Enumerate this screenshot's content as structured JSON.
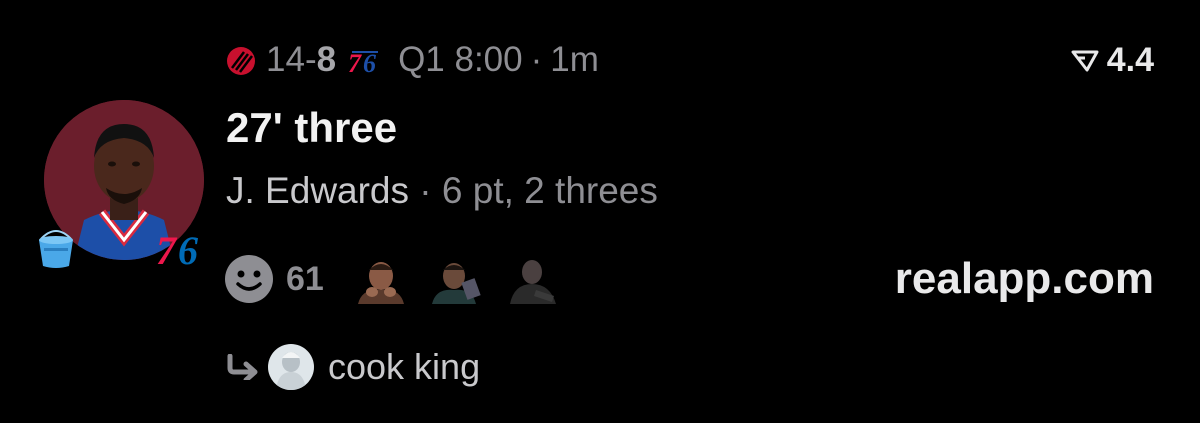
{
  "game": {
    "away_team_icon": "trail-blazers-logo-icon",
    "score_away": "14",
    "score_dash": "-",
    "score_home": "8",
    "home_team_icon": "76ers-logo-icon",
    "quarter_time": "Q1 8:00",
    "separator": "·",
    "age": "1m"
  },
  "rating": {
    "value": "4.4",
    "icon": "flag-check-icon"
  },
  "post": {
    "title": "27' three",
    "player": "J. Edwards",
    "separator": "·",
    "stats": "6 pt, 2 threes"
  },
  "reactions": {
    "count": "61",
    "icon": "smiley-face-icon"
  },
  "site": {
    "label": "realapp.com"
  },
  "reply": {
    "icon": "reply-arrow-icon",
    "name": "cook king"
  },
  "colors": {
    "background": "#000000",
    "muted": "#8e8e93",
    "text": "#f2f2f2",
    "sixers_red": "#ed174c",
    "sixers_blue": "#006bb6",
    "avatar_bg": "#6e1f2e"
  }
}
